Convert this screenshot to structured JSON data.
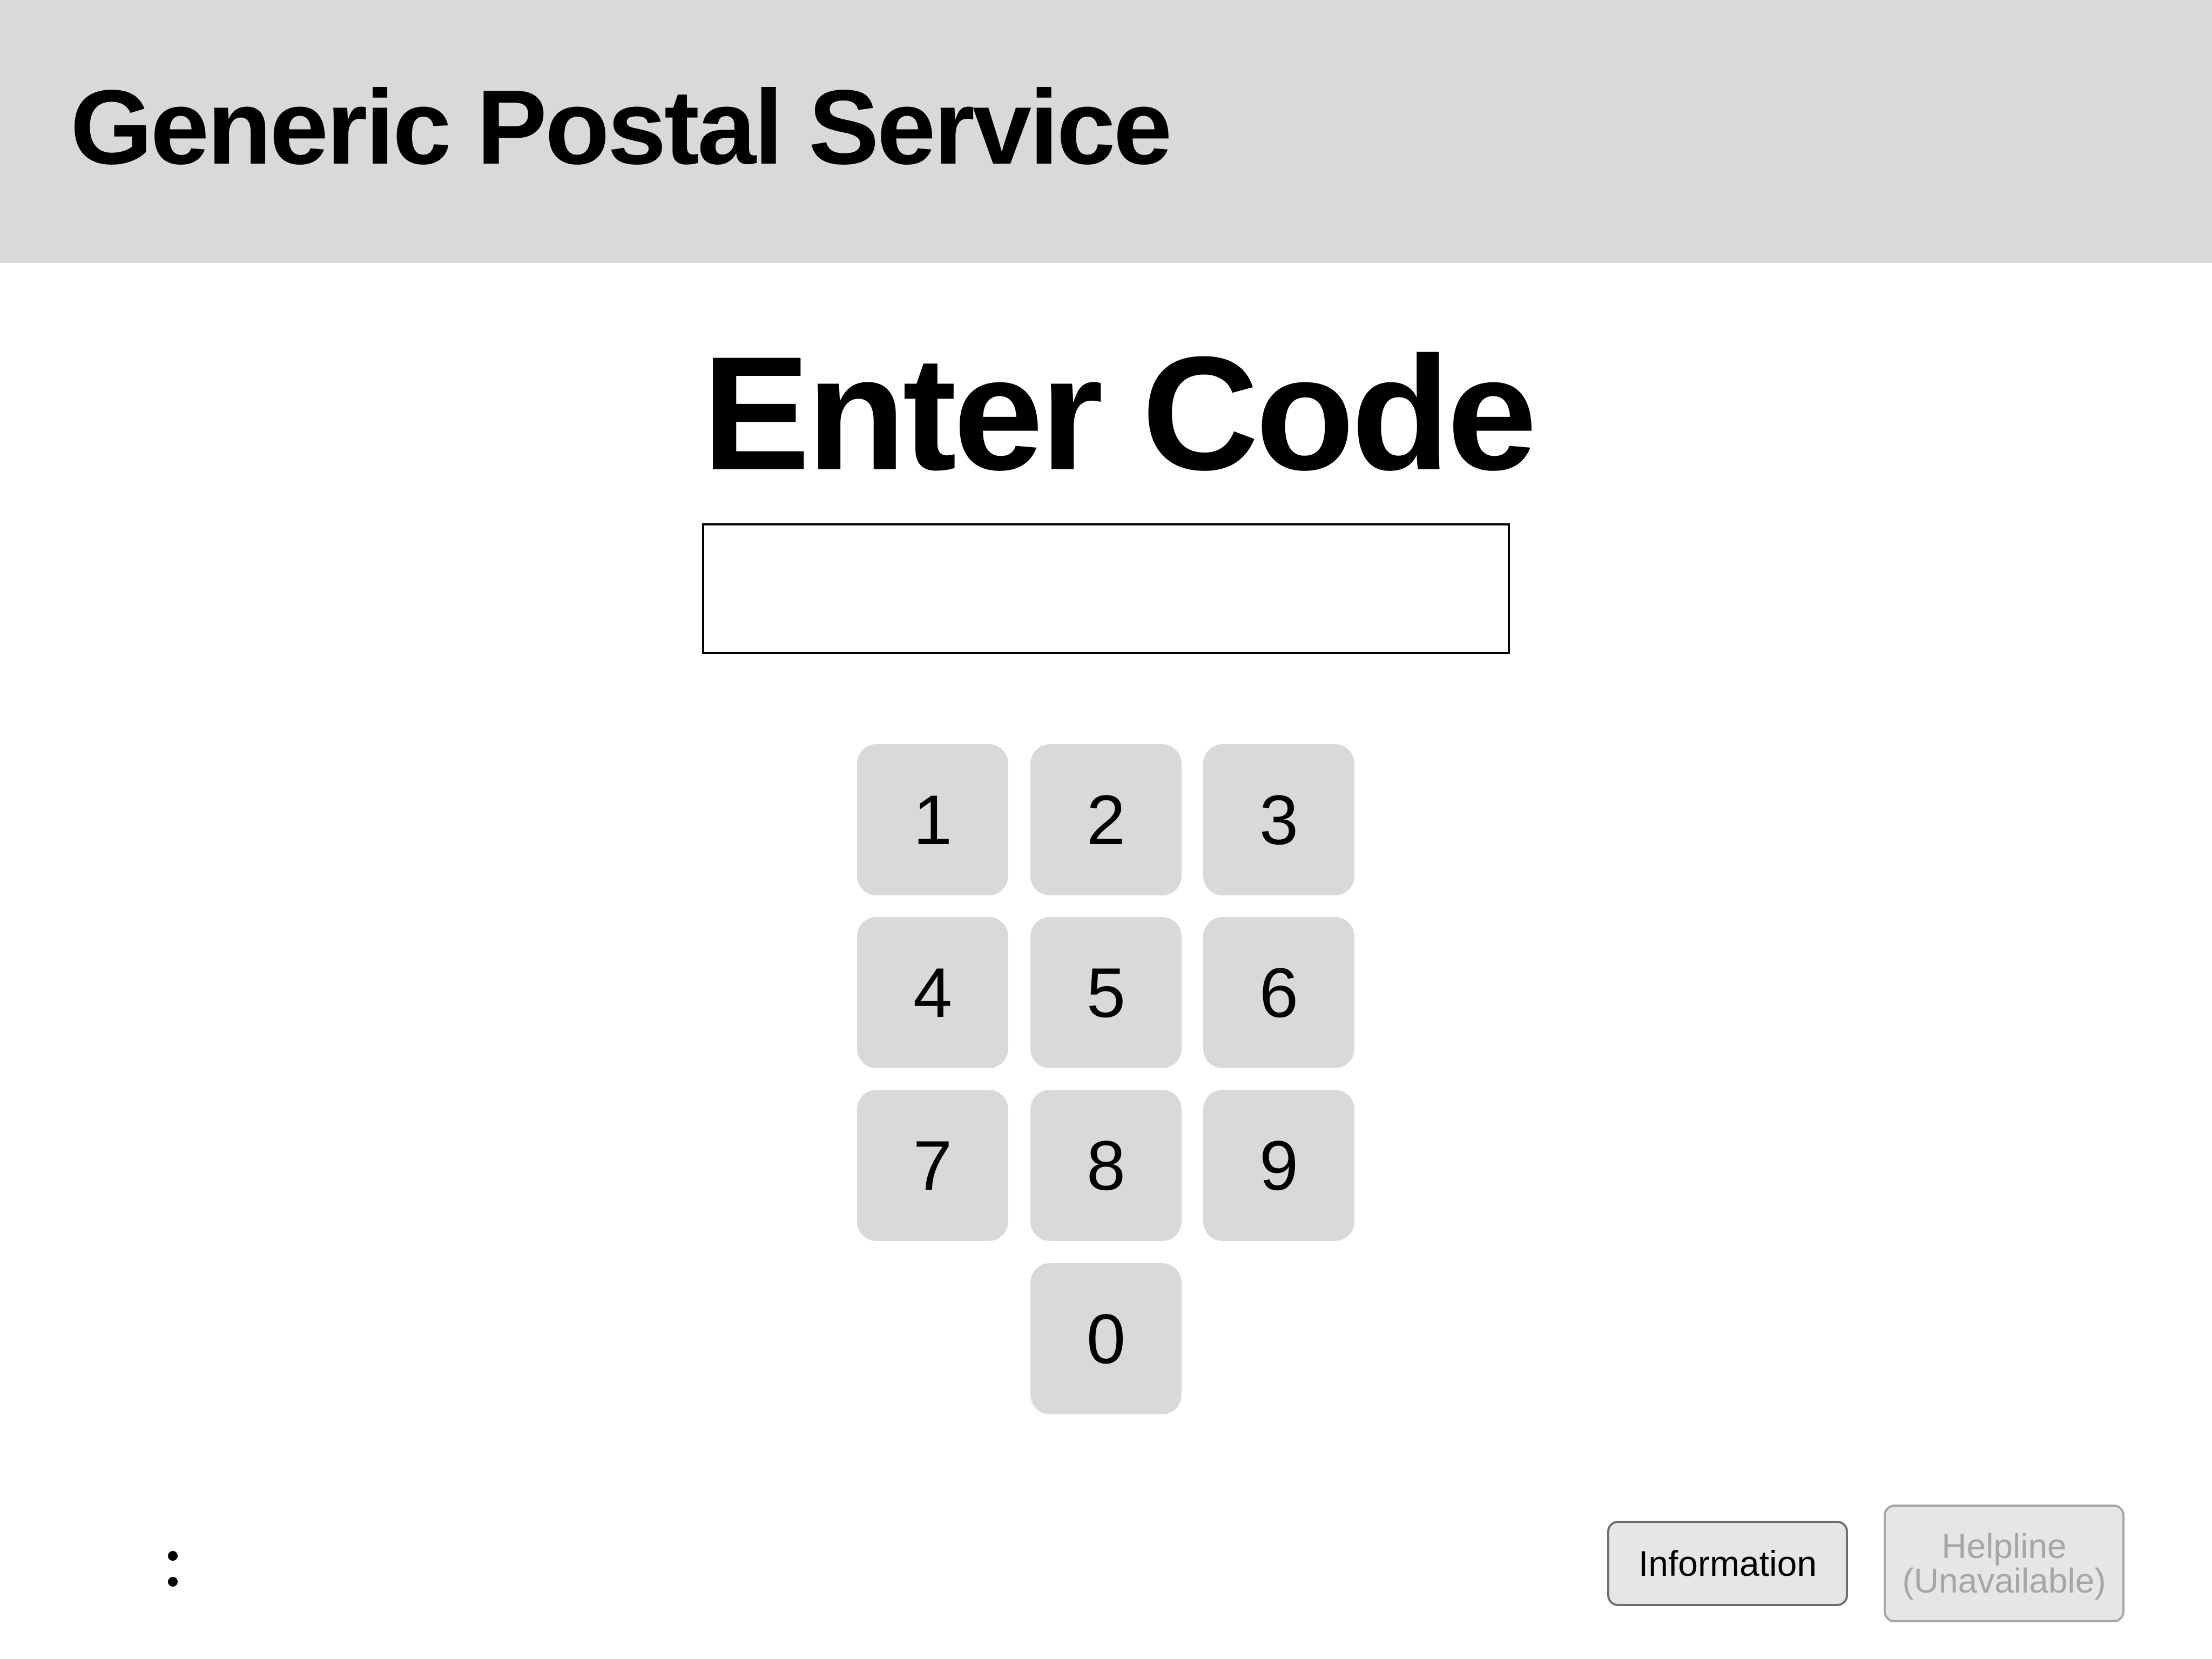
{
  "header": {
    "title": "Generic Postal Service"
  },
  "main": {
    "title": "Enter Code",
    "code_input": {
      "value": "",
      "placeholder": ""
    },
    "keypad": {
      "keys": [
        "1",
        "2",
        "3",
        "4",
        "5",
        "6",
        "7",
        "8",
        "9",
        "0"
      ]
    }
  },
  "footer": {
    "more_icon": "vertical-dots-icon",
    "information_label": "Information",
    "helpline_label_line1": "Helpline",
    "helpline_label_line2": "(Unavailable)"
  },
  "colors": {
    "header_background": "#d9d9d9",
    "key_background": "#d9d9d9",
    "disabled_text": "#a6a6a6"
  }
}
